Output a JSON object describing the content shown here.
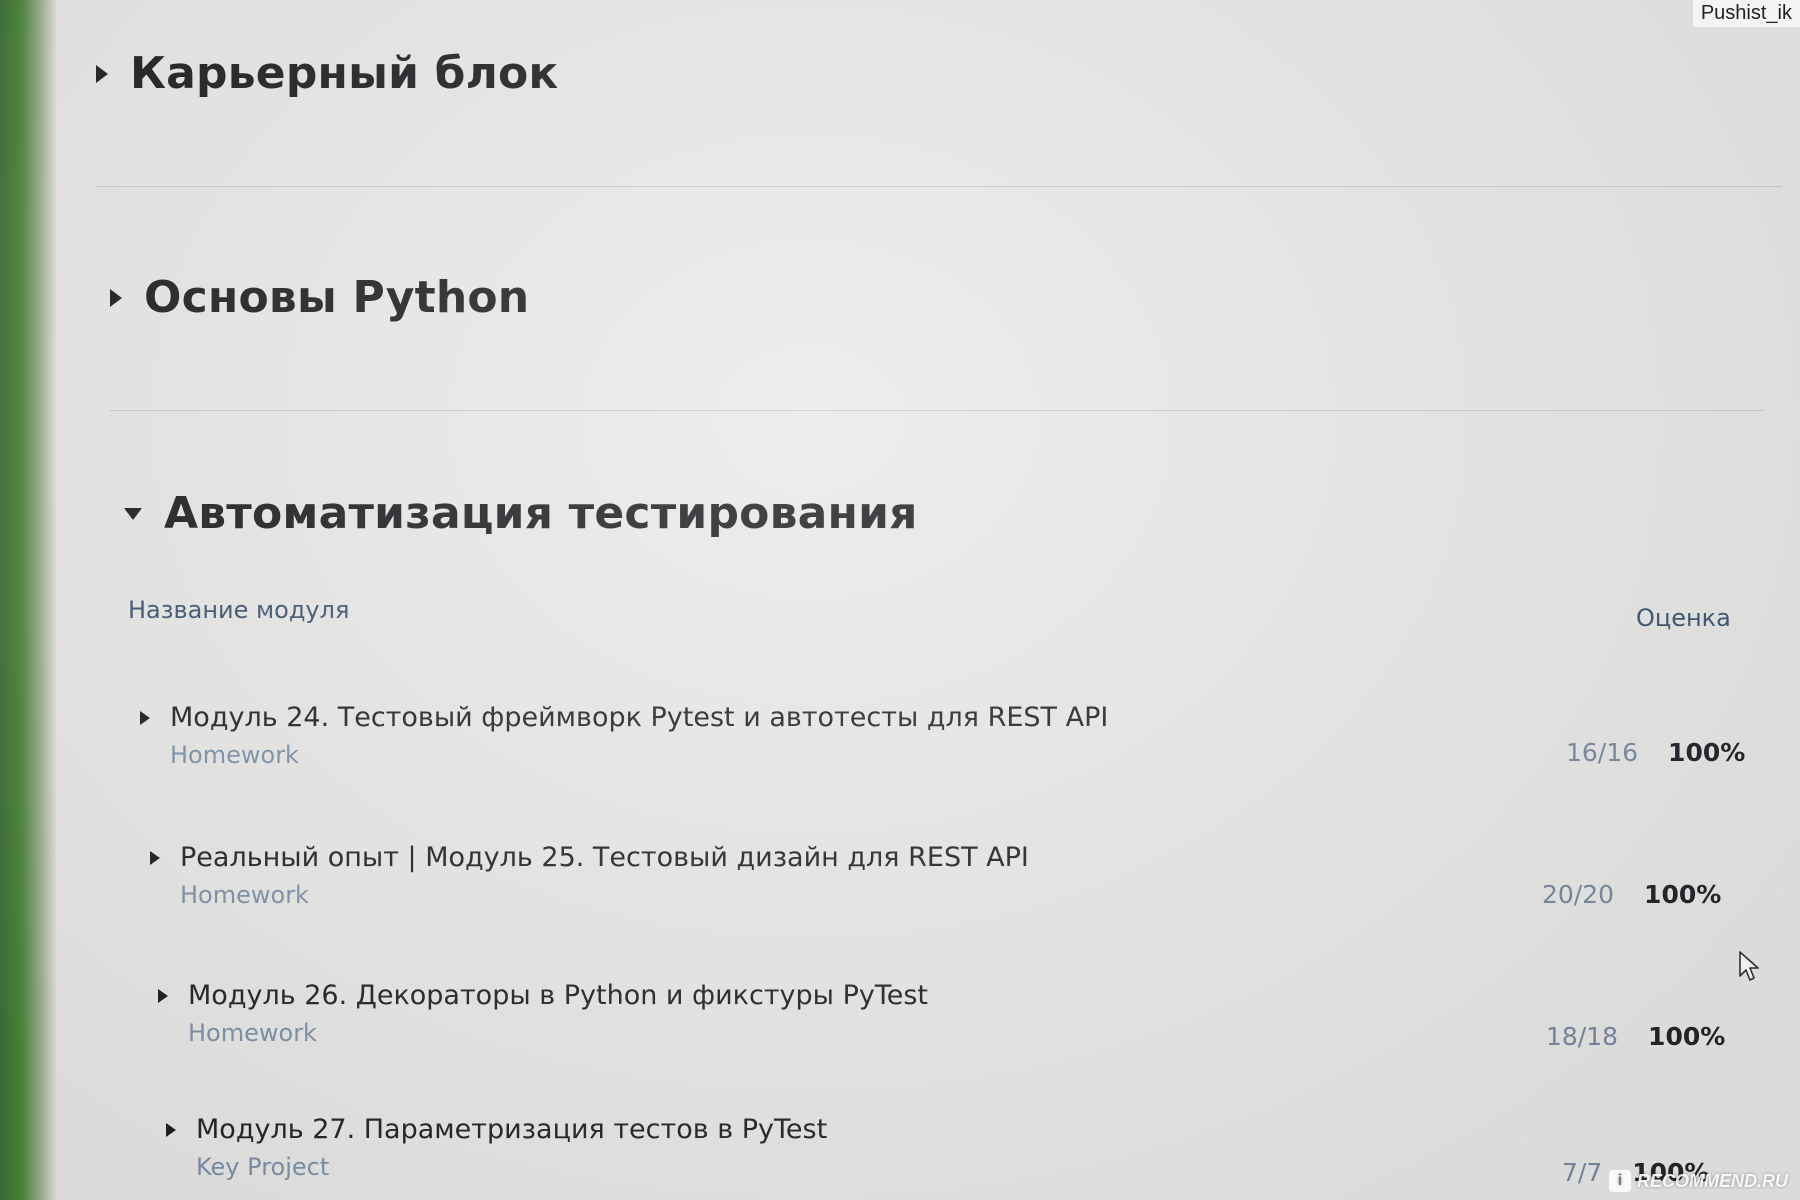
{
  "sections": [
    {
      "title": "Карьерный блок",
      "expanded": false
    },
    {
      "title": "Основы Python",
      "expanded": false
    },
    {
      "title": "Автоматизация тестирования",
      "expanded": true
    }
  ],
  "table": {
    "col_name": "Название модуля",
    "col_grade": "Оценка"
  },
  "modules": [
    {
      "title": "Модуль 24. Тестовый фреймворк Pytest и автотесты для REST API",
      "type": "Homework",
      "count": "16/16",
      "percent": "100%"
    },
    {
      "title": "Реальный опыт | Модуль 25. Тестовый дизайн для REST API",
      "type": "Homework",
      "count": "20/20",
      "percent": "100%"
    },
    {
      "title": "Модуль 26. Декораторы в Python и фикстуры PyTest",
      "type": "Homework",
      "count": "18/18",
      "percent": "100%"
    },
    {
      "title": "Модуль 27. Параметризация тестов в PyTest",
      "type": "Key Project",
      "count": "7/7",
      "percent": "100%"
    }
  ],
  "watermarks": {
    "user": "Pushist_ik",
    "site": "RECOMMEND.RU",
    "site_badge": "i"
  },
  "icons": {
    "collapsed": "triangle-right-icon",
    "expanded": "triangle-down-icon",
    "cursor": "mouse-pointer-icon"
  }
}
